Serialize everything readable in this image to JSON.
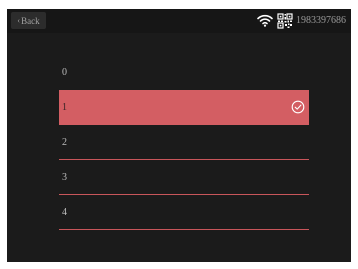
{
  "topbar": {
    "back_label": "Back",
    "device_id": "1983397686",
    "wifi_icon": "wifi-icon",
    "qr_icon": "qr-code-icon"
  },
  "list": {
    "items": [
      {
        "label": "0",
        "selected": false
      },
      {
        "label": "1",
        "selected": true
      },
      {
        "label": "2",
        "selected": false
      },
      {
        "label": "3",
        "selected": false
      },
      {
        "label": "4",
        "selected": false
      }
    ],
    "check_icon": "check-circle-icon"
  },
  "colors": {
    "background": "#1b1b1b",
    "accent": "#d35e63",
    "divider": "#c9565b",
    "text": "#bdbdbd"
  }
}
